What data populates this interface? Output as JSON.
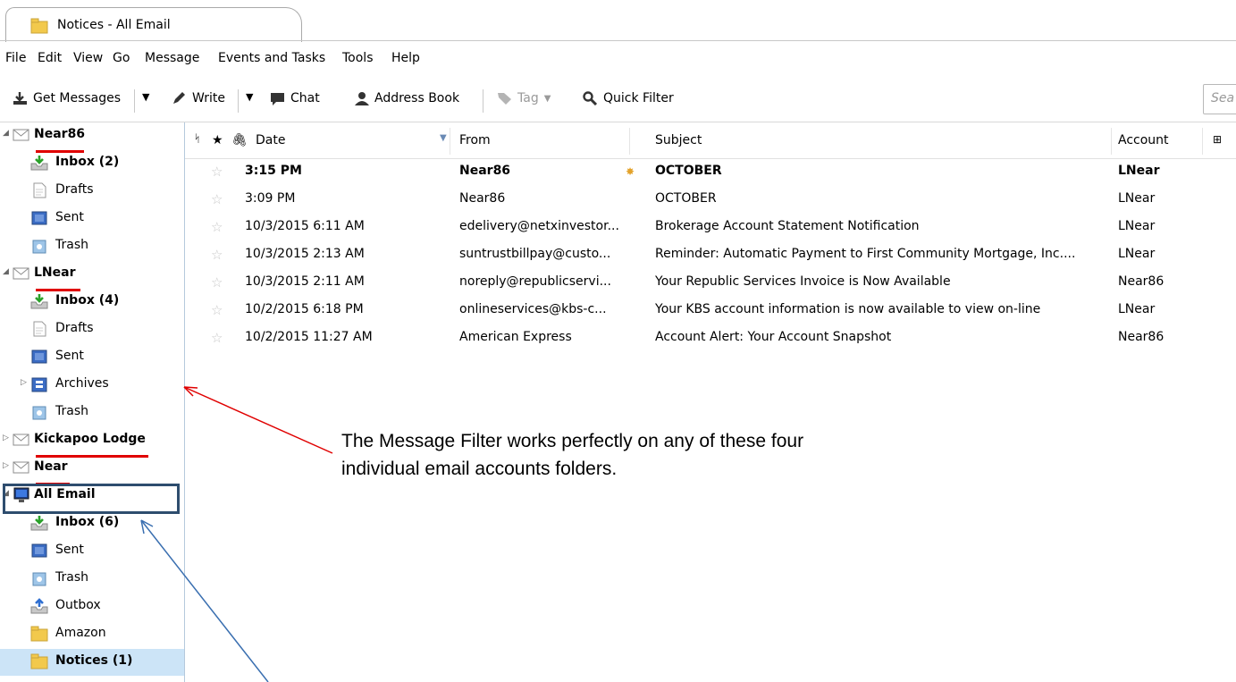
{
  "window": {
    "tab_title": "Notices - All Email"
  },
  "menu": [
    "File",
    "Edit",
    "View",
    "Go",
    "Message",
    "Events and Tasks",
    "Tools",
    "Help"
  ],
  "toolbar": {
    "get_messages": "Get Messages",
    "write": "Write",
    "chat": "Chat",
    "address_book": "Address Book",
    "tag": "Tag",
    "quick_filter": "Quick Filter",
    "search_placeholder": "Sea"
  },
  "folders": [
    {
      "label": "Near86",
      "kind": "account",
      "bold": true,
      "icon": "envelope-icon",
      "expanded": true
    },
    {
      "label": "Inbox (2)",
      "kind": "folder",
      "bold": true,
      "icon": "inbox-icon"
    },
    {
      "label": "Drafts",
      "kind": "folder",
      "icon": "drafts-icon"
    },
    {
      "label": "Sent",
      "kind": "folder",
      "icon": "sent-icon"
    },
    {
      "label": "Trash",
      "kind": "folder",
      "icon": "trash-icon"
    },
    {
      "label": "LNear",
      "kind": "account",
      "bold": true,
      "icon": "envelope-icon",
      "expanded": true
    },
    {
      "label": "Inbox (4)",
      "kind": "folder",
      "bold": true,
      "icon": "inbox-icon"
    },
    {
      "label": "Drafts",
      "kind": "folder",
      "icon": "drafts-icon"
    },
    {
      "label": "Sent",
      "kind": "folder",
      "icon": "sent-icon"
    },
    {
      "label": "Archives",
      "kind": "folder",
      "icon": "archives-icon",
      "collapsed": true
    },
    {
      "label": "Trash",
      "kind": "folder",
      "icon": "trash-icon"
    },
    {
      "label": "Kickapoo Lodge",
      "kind": "account",
      "bold": true,
      "icon": "envelope-icon",
      "collapsed": true
    },
    {
      "label": "Near",
      "kind": "account",
      "bold": true,
      "icon": "envelope-icon",
      "collapsed": true
    },
    {
      "label": "All Email",
      "kind": "account",
      "bold": true,
      "icon": "computer-icon",
      "expanded": true
    },
    {
      "label": "Inbox (6)",
      "kind": "folder",
      "bold": true,
      "icon": "inbox-icon"
    },
    {
      "label": "Sent",
      "kind": "folder",
      "icon": "sent-icon"
    },
    {
      "label": "Trash",
      "kind": "folder",
      "icon": "trash-icon"
    },
    {
      "label": "Outbox",
      "kind": "folder",
      "icon": "outbox-icon"
    },
    {
      "label": "Amazon",
      "kind": "folder",
      "icon": "folder-icon"
    },
    {
      "label": "Notices (1)",
      "kind": "folder",
      "bold": true,
      "icon": "folder-icon",
      "selected": true
    }
  ],
  "columns": {
    "date": "Date",
    "from": "From",
    "subject": "Subject",
    "account": "Account"
  },
  "messages": [
    {
      "date": "3:15 PM",
      "from": "Near86",
      "subject": "OCTOBER",
      "account": "LNear",
      "unread": true
    },
    {
      "date": "3:09 PM",
      "from": "Near86",
      "subject": "OCTOBER",
      "account": "LNear"
    },
    {
      "date": "10/3/2015 6:11 AM",
      "from": "edelivery@netxinvestor...",
      "subject": "Brokerage Account Statement Notification",
      "account": "LNear"
    },
    {
      "date": "10/3/2015 2:13 AM",
      "from": "suntrustbillpay@custo...",
      "subject": "Reminder: Automatic Payment to First Community Mortgage, Inc....",
      "account": "LNear"
    },
    {
      "date": "10/3/2015 2:11 AM",
      "from": "noreply@republicservi...",
      "subject": "Your Republic Services Invoice is Now Available",
      "account": "Near86"
    },
    {
      "date": "10/2/2015 6:18 PM",
      "from": "onlineservices@kbs-c...",
      "subject": "Your KBS account information is now available to view on-line",
      "account": "LNear"
    },
    {
      "date": "10/2/2015 11:27 AM",
      "from": "American Express",
      "subject": "Account Alert: Your Account Snapshot",
      "account": "Near86"
    }
  ],
  "annotation": {
    "text": "The Message Filter works perfectly on any of these four individual email accounts folders."
  },
  "colors": {
    "selected": "#cce4f7",
    "underline": "#e00000",
    "highlight_box": "#2e4d6e",
    "red_arrow": "#e00000",
    "blue_arrow": "#3a6fb0"
  }
}
